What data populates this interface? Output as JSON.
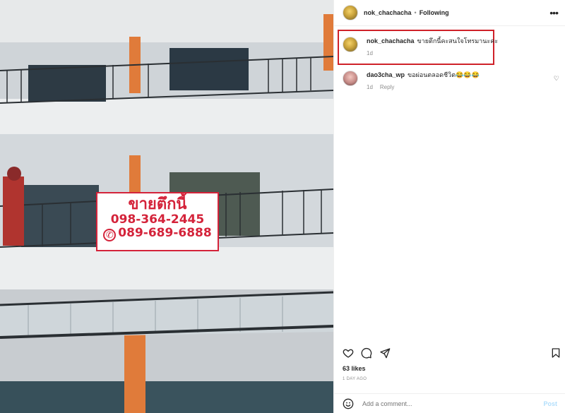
{
  "photo": {
    "sign": {
      "title": "ขายตึกนี้",
      "phone1": "098-364-2445",
      "phone2": "089-689-6888"
    }
  },
  "header": {
    "username": "nok_chachacha",
    "separator": "•",
    "follow_label": "Following",
    "more_icon": "more-horizontal-icon"
  },
  "caption": {
    "username": "nok_chachacha",
    "text": "ขายตึกนี้คะสนใจโทรมานะคะ",
    "age": "1d"
  },
  "comments": [
    {
      "username": "dao3cha_wp",
      "text": "ขอผ่อนตลอดชีวิต😂😂😂",
      "age": "1d",
      "reply_label": "Reply"
    }
  ],
  "actions": {
    "like_icon": "heart-icon",
    "comment_icon": "comment-icon",
    "share_icon": "send-icon",
    "save_icon": "bookmark-icon"
  },
  "likes": "63 likes",
  "posted": "1 DAY AGO",
  "add_comment": {
    "placeholder": "Add a comment...",
    "post_label": "Post",
    "emoji_icon": "smiley-icon"
  },
  "colors": {
    "sign_red": "#d4233a",
    "highlight_red": "#cf2129",
    "post_blue": "#b2dffc",
    "meta_gray": "#8e8e8e"
  }
}
